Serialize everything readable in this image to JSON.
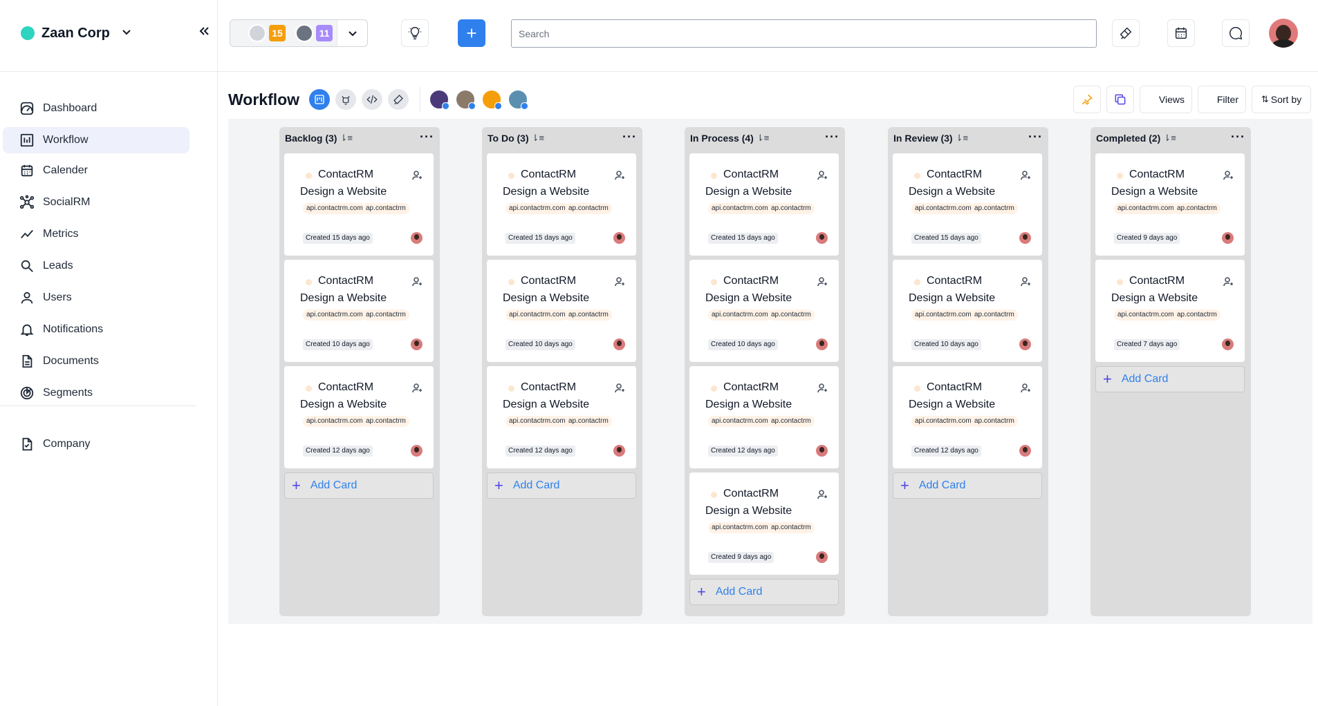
{
  "sidebar": {
    "brand": "Zaan Corp",
    "brand_color": "#2dd4bf",
    "nav": [
      {
        "label": "Dashboard",
        "icon": "dashboard-icon",
        "active": false
      },
      {
        "label": "Workflow",
        "icon": "workflow-icon",
        "active": true
      },
      {
        "label": "Calender",
        "icon": "calendar-icon",
        "active": false
      },
      {
        "label": "SocialRM",
        "icon": "network-icon",
        "active": false
      },
      {
        "label": "Metrics",
        "icon": "trend-icon",
        "active": false
      },
      {
        "label": "Leads",
        "icon": "search-icon",
        "active": false
      },
      {
        "label": "Users",
        "icon": "user-icon",
        "active": false
      },
      {
        "label": "Notifications",
        "icon": "bell-icon",
        "active": false
      },
      {
        "label": "Documents",
        "icon": "document-icon",
        "active": false
      },
      {
        "label": "Segments",
        "icon": "segments-icon",
        "active": false
      }
    ],
    "nav2": [
      {
        "label": "Company",
        "icon": "company-icon",
        "active": false
      }
    ]
  },
  "topbar": {
    "team_badges": [
      {
        "count": "15",
        "color": "#f59e0b"
      },
      {
        "count": "11",
        "color": "#a78bfa"
      }
    ],
    "search_placeholder": "Search",
    "accent": "#2f80ed"
  },
  "workflow": {
    "title": "Workflow",
    "toolbar": {
      "views": "Views",
      "filter": "Filter",
      "sort": "Sort by"
    },
    "add_card_label": "Add Card",
    "columns": [
      {
        "title": "Backlog (3)",
        "cards": [
          {
            "company": "ContactRM",
            "title": "Design a Website",
            "tag1": "api.contactrm.com",
            "tag2": "ap.contactrm",
            "created": "Created 15 days ago"
          },
          {
            "company": "ContactRM",
            "title": "Design a Website",
            "tag1": "api.contactrm.com",
            "tag2": "ap.contactrm",
            "created": "Created 10 days ago"
          },
          {
            "company": "ContactRM",
            "title": "Design a Website",
            "tag1": "api.contactrm.com",
            "tag2": "ap.contactrm",
            "created": "Created 12 days ago"
          }
        ]
      },
      {
        "title": "To Do (3)",
        "cards": [
          {
            "company": "ContactRM",
            "title": "Design a Website",
            "tag1": "api.contactrm.com",
            "tag2": "ap.contactrm",
            "created": "Created 15 days ago"
          },
          {
            "company": "ContactRM",
            "title": "Design a Website",
            "tag1": "api.contactrm.com",
            "tag2": "ap.contactrm",
            "created": "Created 10 days ago"
          },
          {
            "company": "ContactRM",
            "title": "Design a Website",
            "tag1": "api.contactrm.com",
            "tag2": "ap.contactrm",
            "created": "Created 12 days ago"
          }
        ]
      },
      {
        "title": "In Process (4)",
        "cards": [
          {
            "company": "ContactRM",
            "title": "Design a Website",
            "tag1": "api.contactrm.com",
            "tag2": "ap.contactrm",
            "created": "Created 15 days ago"
          },
          {
            "company": "ContactRM",
            "title": "Design a Website",
            "tag1": "api.contactrm.com",
            "tag2": "ap.contactrm",
            "created": "Created 10 days ago"
          },
          {
            "company": "ContactRM",
            "title": "Design a Website",
            "tag1": "api.contactrm.com",
            "tag2": "ap.contactrm",
            "created": "Created 12 days ago"
          },
          {
            "company": "ContactRM",
            "title": "Design a Website",
            "tag1": "api.contactrm.com",
            "tag2": "ap.contactrm",
            "created": "Created 9 days ago"
          }
        ]
      },
      {
        "title": "In Review (3)",
        "cards": [
          {
            "company": "ContactRM",
            "title": "Design a Website",
            "tag1": "api.contactrm.com",
            "tag2": "ap.contactrm",
            "created": "Created 15 days ago"
          },
          {
            "company": "ContactRM",
            "title": "Design a Website",
            "tag1": "api.contactrm.com",
            "tag2": "ap.contactrm",
            "created": "Created 10 days ago"
          },
          {
            "company": "ContactRM",
            "title": "Design a Website",
            "tag1": "api.contactrm.com",
            "tag2": "ap.contactrm",
            "created": "Created 12 days ago"
          }
        ]
      },
      {
        "title": "Completed (2)",
        "cards": [
          {
            "company": "ContactRM",
            "title": "Design a Website",
            "tag1": "api.contactrm.com",
            "tag2": "ap.contactrm",
            "created": "Created 9 days ago"
          },
          {
            "company": "ContactRM",
            "title": "Design a Website",
            "tag1": "api.contactrm.com",
            "tag2": "ap.contactrm",
            "created": "Created 7 days ago"
          }
        ]
      }
    ]
  }
}
